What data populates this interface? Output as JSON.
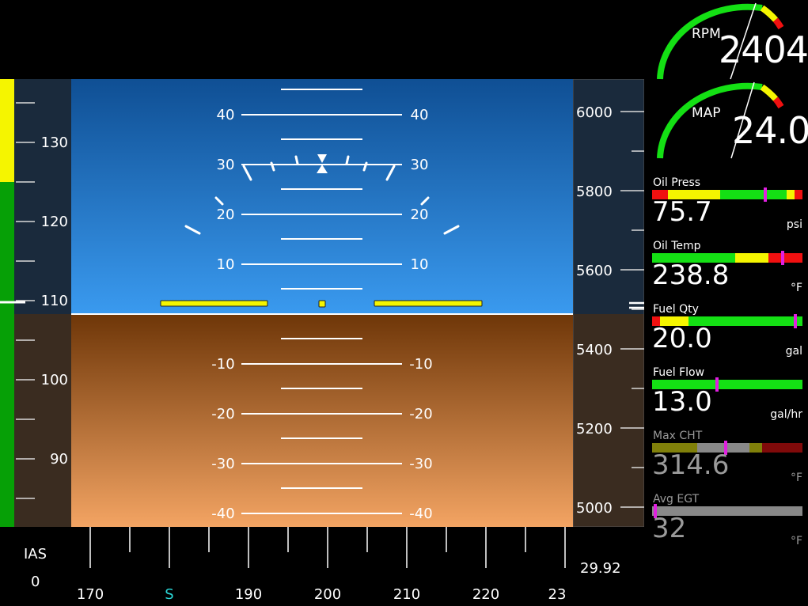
{
  "pfd": {
    "pitch_labels_upper": [
      "40",
      "30",
      "20",
      "10"
    ],
    "pitch_labels_lower": [
      "-10",
      "-20",
      "-30",
      "-40"
    ],
    "airspeed": {
      "label": "IAS",
      "value": "0",
      "ticks": [
        "130",
        "120",
        "110",
        "100",
        "90"
      ]
    },
    "altitude": {
      "ticks": [
        "6000",
        "5800",
        "5600",
        "5400",
        "5200",
        "5000"
      ],
      "baro": "29.92"
    },
    "heading": {
      "labels": [
        "170",
        "S",
        "190",
        "200",
        "210",
        "220",
        "23"
      ]
    }
  },
  "engine": {
    "rpm": {
      "label": "RPM",
      "value": "2404"
    },
    "map": {
      "label": "MAP",
      "value": "24.0"
    },
    "oil_press": {
      "label": "Oil Press",
      "value": "75.7",
      "unit": "psi",
      "level": 0.75
    },
    "oil_temp": {
      "label": "Oil Temp",
      "value": "238.8",
      "unit": "°F",
      "level": 0.87
    },
    "fuel_qty": {
      "label": "Fuel Qty",
      "value": "20.0",
      "unit": "gal",
      "level": 0.95
    },
    "fuel_flow": {
      "label": "Fuel Flow",
      "value": "13.0",
      "unit": "gal/hr",
      "level": 0.43
    },
    "max_cht": {
      "label": "Max CHT",
      "value": "314.6",
      "unit": "°F",
      "level": 0.49
    },
    "avg_egt": {
      "label": "Avg EGT",
      "value": "32",
      "unit": "°F",
      "level": 0.02
    }
  },
  "colors": {
    "sky_top": "#0f4f94",
    "sky_bottom": "#3a9aef",
    "ground_top": "#6e3608",
    "ground_bottom": "#f3a463",
    "green": "#14e014",
    "yellow": "#f5f500",
    "red": "#f01010",
    "magenta": "#e020e0"
  }
}
